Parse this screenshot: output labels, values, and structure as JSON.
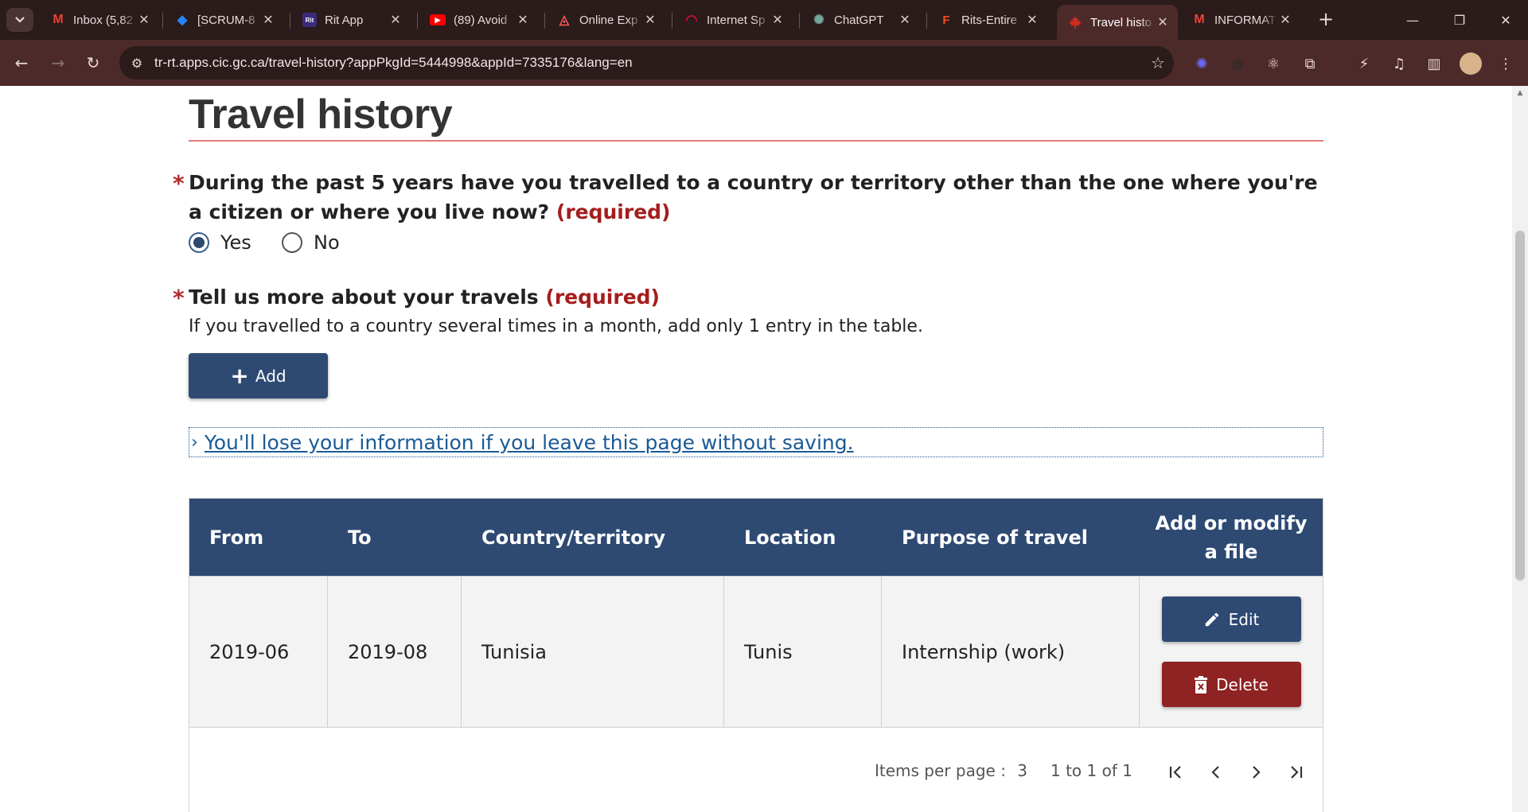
{
  "browser": {
    "tabs": [
      {
        "title": "Inbox (5,82",
        "icon": "gmail-icon",
        "color": "#ea4335",
        "glyph": "M"
      },
      {
        "title": "[SCRUM-8",
        "icon": "jira-icon",
        "color": "#2684ff",
        "glyph": "◆"
      },
      {
        "title": "Rit App",
        "icon": "rit-icon",
        "color": "#3b2a7a",
        "glyph": "Rit"
      },
      {
        "title": "(89) Avoid",
        "icon": "youtube-icon",
        "color": "#ff0000",
        "glyph": "▶"
      },
      {
        "title": "Online Exp",
        "icon": "airbnb-icon",
        "color": "#ff5a5f",
        "glyph": "◬"
      },
      {
        "title": "Internet Sp",
        "icon": "speedtest-icon",
        "color": "#c8102e",
        "glyph": "◠"
      },
      {
        "title": "ChatGPT",
        "icon": "chatgpt-icon",
        "color": "#74aa9c",
        "glyph": "✺"
      },
      {
        "title": "Rits-Entire",
        "icon": "figma-icon",
        "color": "#f24e1e",
        "glyph": "F"
      },
      {
        "title": "Travel histo",
        "icon": "canada-maple-icon",
        "color": "#d52b1e",
        "glyph": "🍁",
        "active": true
      },
      {
        "title": "INFORMAT",
        "icon": "gmail-icon",
        "color": "#ea4335",
        "glyph": "M"
      }
    ],
    "url": "tr-rt.apps.cic.gc.ca/travel-history?appPkgId=5444998&appId=7335176&lang=en"
  },
  "page": {
    "title": "Travel history",
    "question1": {
      "label": "During the past 5 years have you travelled to a country or territory other than the one where you're a citizen or where you live now?",
      "required": "(required)",
      "options": [
        "Yes",
        "No"
      ],
      "selected": "Yes"
    },
    "question2": {
      "label": "Tell us more about your travels",
      "required": "(required)",
      "help": "If you travelled to a country several times in a month, add only 1 entry in the table."
    },
    "add_button": "Add",
    "details_link": "You'll lose your information if you leave this page without saving.",
    "table": {
      "headers": [
        "From",
        "To",
        "Country/territory",
        "Location",
        "Purpose of travel",
        "Add or modify a file"
      ],
      "rows": [
        {
          "from": "2019-06",
          "to": "2019-08",
          "country": "Tunisia",
          "location": "Tunis",
          "purpose": "Internship (work)"
        }
      ],
      "edit_label": "Edit",
      "delete_label": "Delete"
    },
    "pagination": {
      "items_per_page_label": "Items per page :",
      "items_per_page": "3",
      "range": "1 to 1 of 1"
    }
  }
}
